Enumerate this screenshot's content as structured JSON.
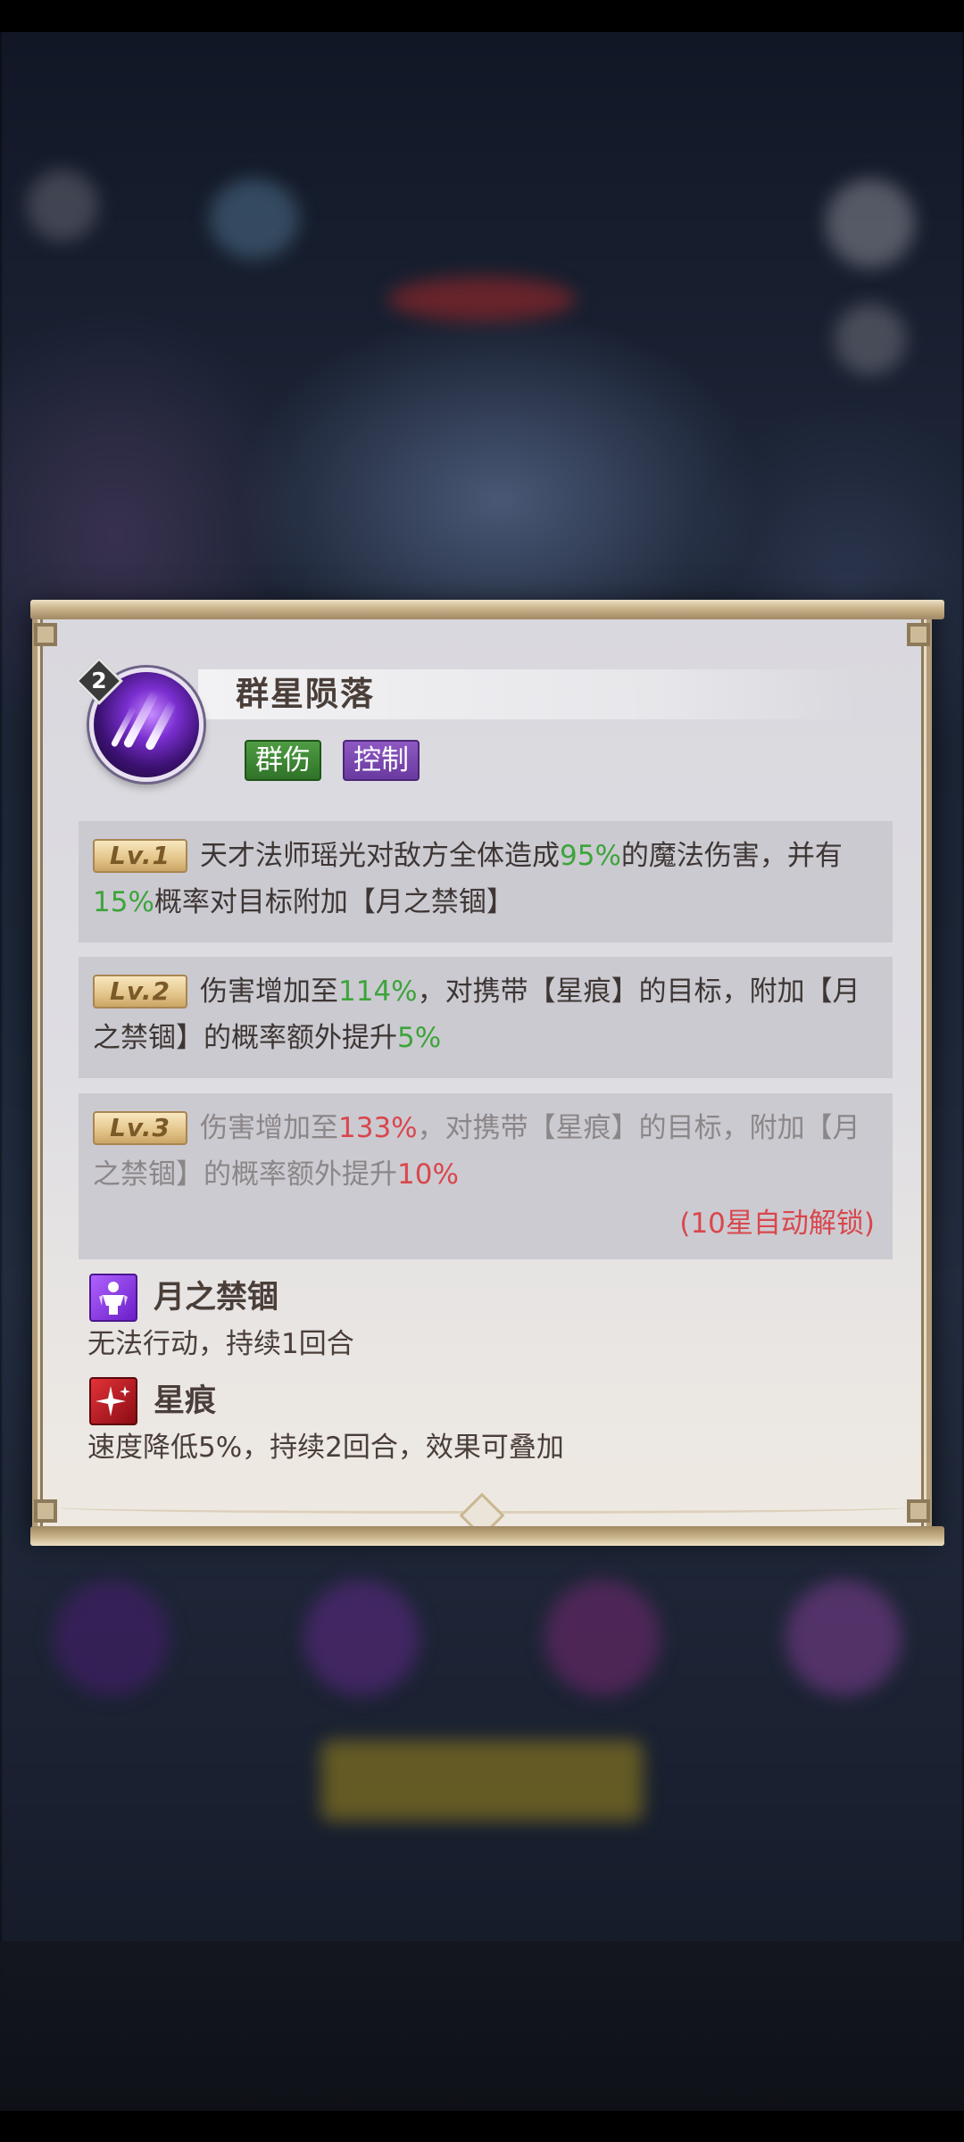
{
  "skill": {
    "level": "2",
    "name": "群星陨落",
    "tags": [
      "群伤",
      "控制"
    ],
    "icon": "meteor-shower-icon",
    "tag_colors": {
      "aoe": "#3f8a36",
      "control": "#7a48b2"
    }
  },
  "levels": [
    {
      "badge": "Lv.1",
      "text_a": "天才法师瑶光对敌方全体造成",
      "val_1": "95%",
      "text_b": "的魔法伤害，并有",
      "val_2": "15%",
      "text_c": "概率对目标附加【月之禁锢】",
      "unlocked": true
    },
    {
      "badge": "Lv.2",
      "text_a": "伤害增加至",
      "val_1": "114%",
      "text_b": "，对携带【星痕】的目标，附加【月之禁锢】的概率额外提升",
      "val_2": "5%",
      "unlocked": true
    },
    {
      "badge": "Lv.3",
      "text_a": "伤害增加至",
      "val_1": "133%",
      "text_b": "，对携带【星痕】的目标，附加【月之禁锢】的概率额外提升",
      "val_2": "10%",
      "unlock_hint": "(10星自动解锁)",
      "unlocked": false
    }
  ],
  "effects": [
    {
      "name": "月之禁锢",
      "desc": "无法行动，持续1回合",
      "icon": "imprison-figure-icon",
      "color": "#9a4be8"
    },
    {
      "name": "星痕",
      "desc": "速度降低5%，持续2回合，效果可叠加",
      "icon": "sparkle-star-icon",
      "color": "#c8202a"
    }
  ],
  "colors": {
    "value_green": "#3da43a",
    "value_red": "#d8474d",
    "locked_text": "#8b8688"
  }
}
